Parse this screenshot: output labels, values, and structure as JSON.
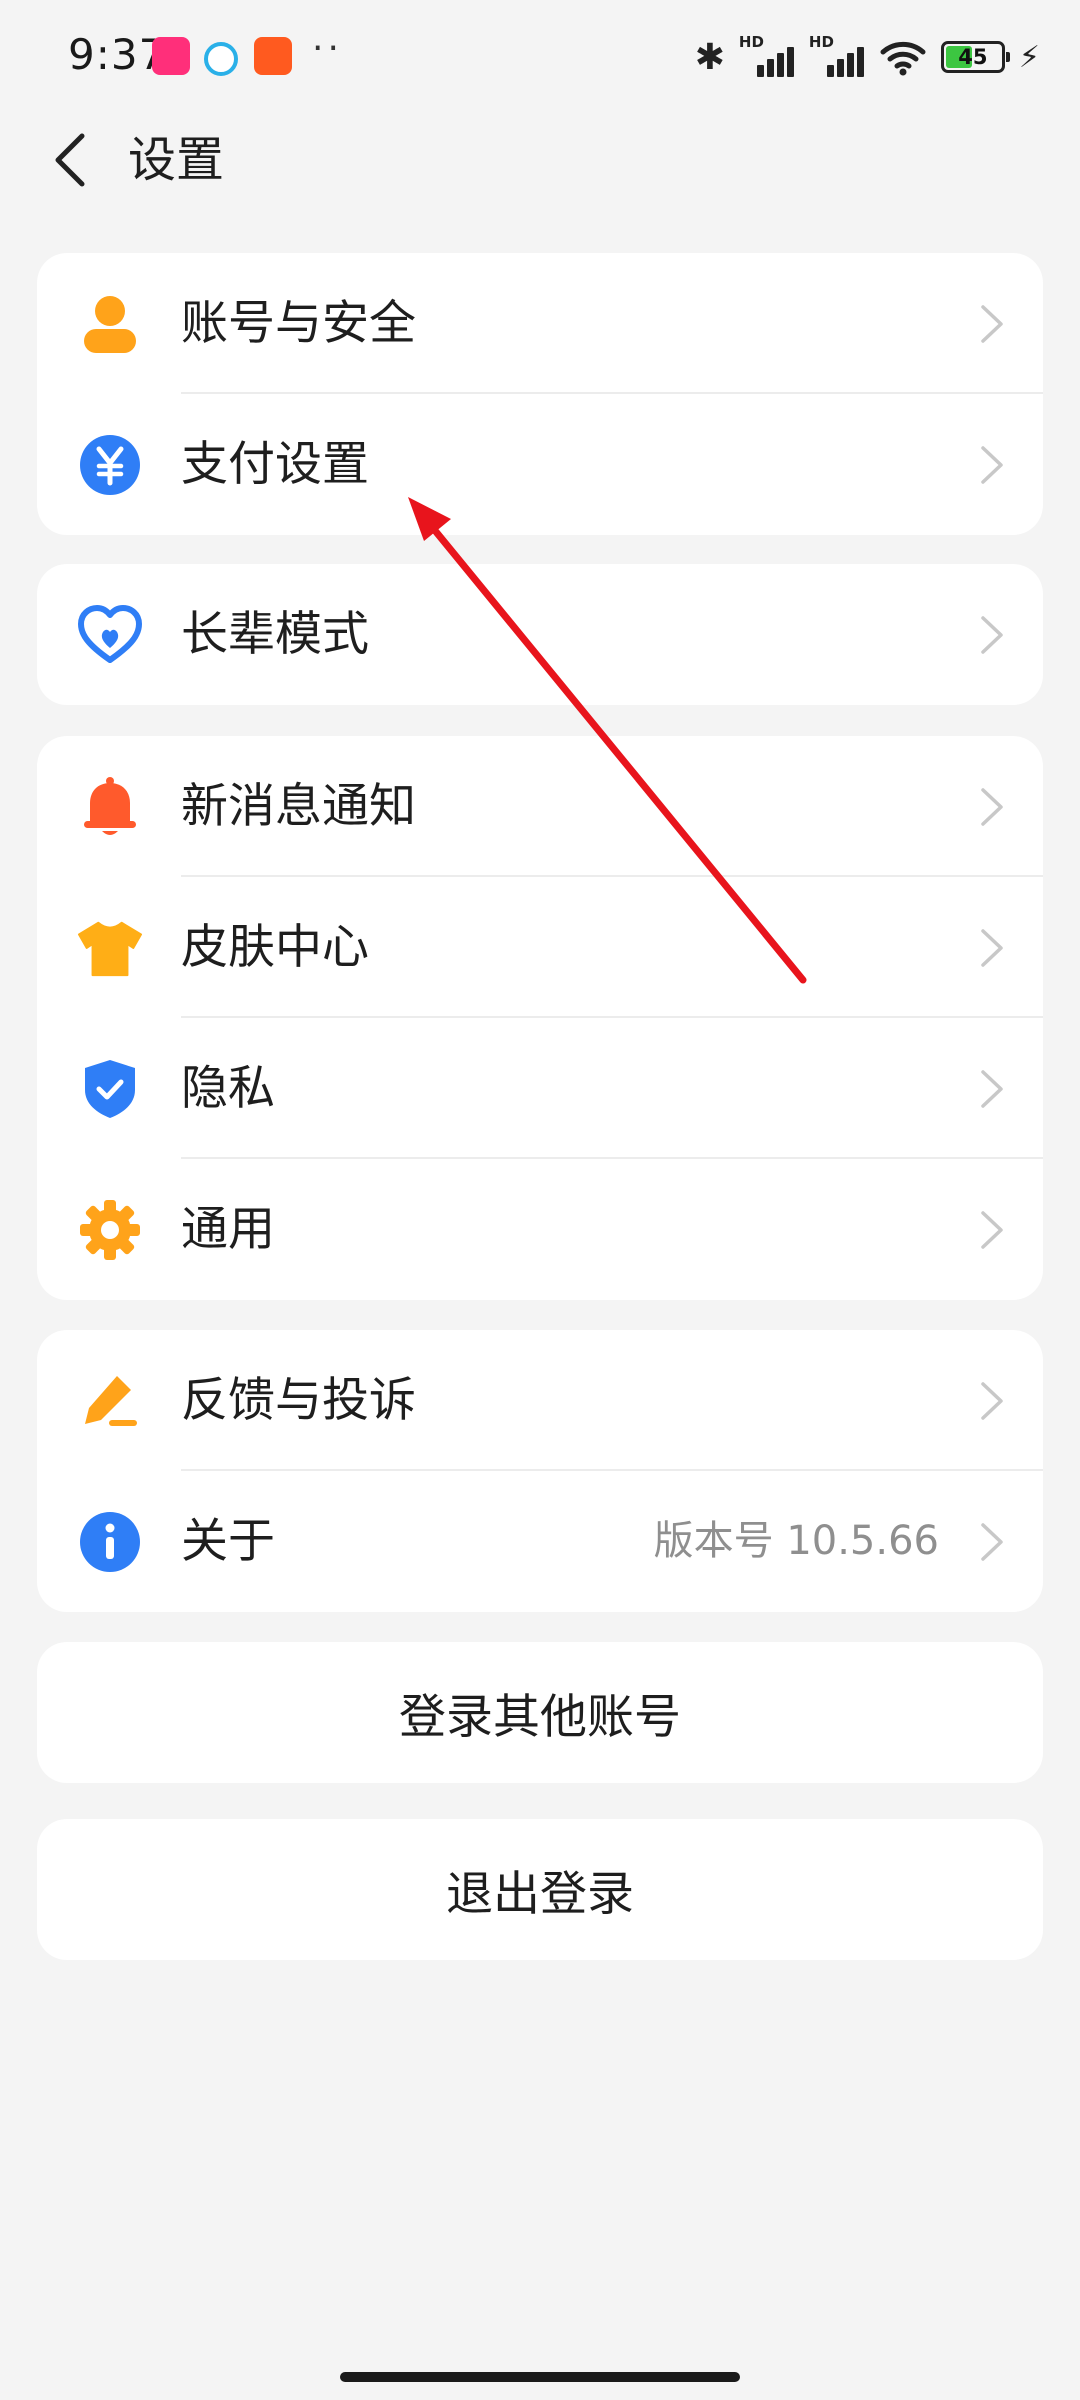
{
  "status_bar": {
    "time": "9:37",
    "dots": "··",
    "battery_level": "45",
    "network_label": "HD"
  },
  "header": {
    "title": "设置"
  },
  "groups": [
    {
      "items": [
        {
          "label": "账号与安全",
          "icon": "user-icon",
          "color": "#ffa31a"
        },
        {
          "label": "支付设置",
          "icon": "yuan-icon",
          "color": "#2f7ef6"
        }
      ]
    },
    {
      "items": [
        {
          "label": "长辈模式",
          "icon": "heart-icon",
          "color": "#2f7ef6"
        }
      ]
    },
    {
      "items": [
        {
          "label": "新消息通知",
          "icon": "bell-icon",
          "color": "#ff5a2c"
        },
        {
          "label": "皮肤中心",
          "icon": "tshirt-icon",
          "color": "#ffae16"
        },
        {
          "label": "隐私",
          "icon": "shield-icon",
          "color": "#2f7ef6"
        },
        {
          "label": "通用",
          "icon": "gear-icon",
          "color": "#ffa31a"
        }
      ]
    },
    {
      "items": [
        {
          "label": "反馈与投诉",
          "icon": "edit-icon",
          "color": "#ffa31a"
        },
        {
          "label": "关于",
          "icon": "info-icon",
          "color": "#2f7ef6",
          "extra": "版本号 10.5.66"
        }
      ]
    }
  ],
  "buttons": {
    "switch_account": "登录其他账号",
    "logout": "退出登录"
  },
  "annotation": {
    "arrow_color": "#e8141c"
  }
}
